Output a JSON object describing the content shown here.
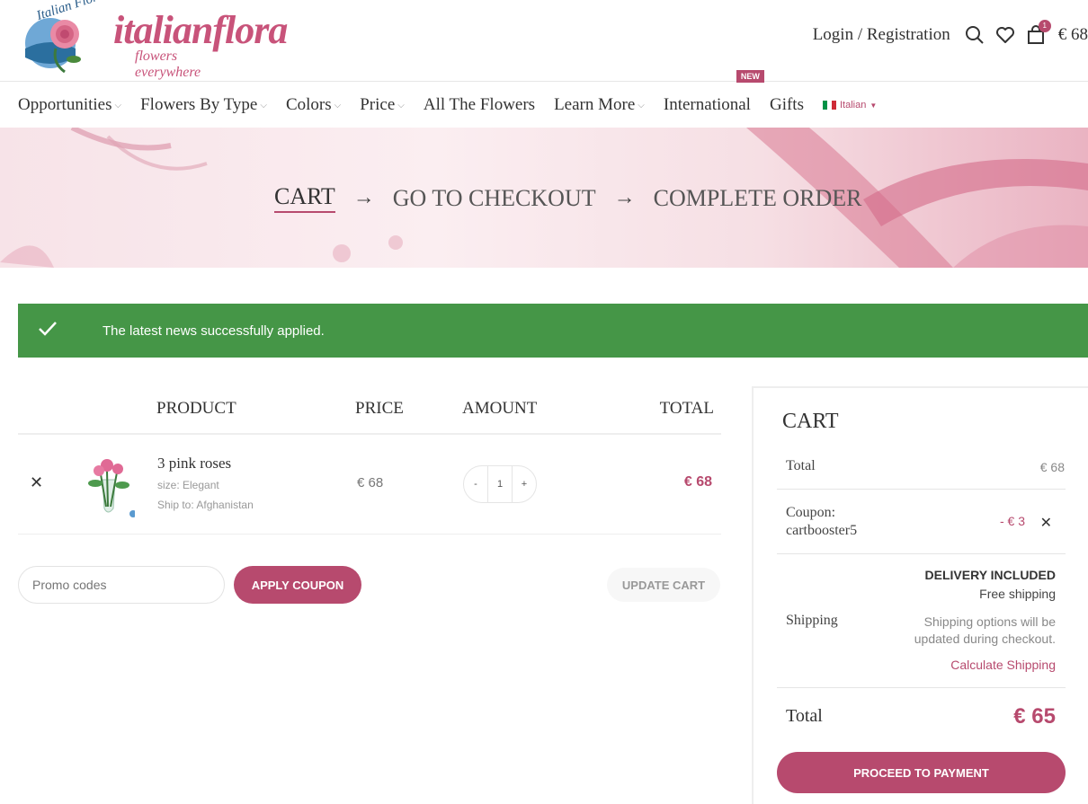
{
  "brand": {
    "logo_top": "Italian Flora",
    "wordmark": "italianflora",
    "tagline": "flowers everywhere"
  },
  "header": {
    "login_label": "Login / Registration",
    "cart_count": "1",
    "cart_total": "€ 68"
  },
  "nav": {
    "items": [
      {
        "label": "Opportunities",
        "has_dropdown": true
      },
      {
        "label": "Flowers By Type",
        "has_dropdown": true
      },
      {
        "label": "Colors",
        "has_dropdown": true
      },
      {
        "label": "Price",
        "has_dropdown": true
      },
      {
        "label": "All The Flowers",
        "has_dropdown": false
      },
      {
        "label": "Learn More",
        "has_dropdown": true
      },
      {
        "label": "International",
        "has_dropdown": false
      },
      {
        "label": "Gifts",
        "has_dropdown": false
      }
    ],
    "new_badge": "NEW",
    "language": "Italian"
  },
  "steps": {
    "cart": "CART",
    "checkout": "GO TO CHECKOUT",
    "complete": "COMPLETE ORDER",
    "arrow": "→"
  },
  "notice": {
    "message": "The latest news successfully applied.",
    "icon": "check-icon"
  },
  "table": {
    "headers": {
      "product": "PRODUCT",
      "price": "PRICE",
      "amount": "AMOUNT",
      "total": "TOTAL"
    },
    "rows": [
      {
        "name": "3 pink roses",
        "size": "size: Elegant",
        "ship_to": "Ship to: Afghanistan",
        "price": "€ 68",
        "qty": "1",
        "minus": "-",
        "plus": "+",
        "total": "€ 68"
      }
    ]
  },
  "coupon": {
    "placeholder": "Promo codes",
    "apply_label": "APPLY COUPON",
    "update_label": "UPDATE CART"
  },
  "totals": {
    "title": "CART",
    "subtotal_label": "Total",
    "subtotal_value": "€ 68",
    "coupon_label": "Coupon:",
    "coupon_code": "cartbooster5",
    "coupon_value": "- € 3",
    "shipping_label": "Shipping",
    "delivery_included": "DELIVERY INCLUDED",
    "free_shipping": "Free shipping",
    "shipping_note": "Shipping options will be updated during checkout.",
    "calc_shipping": "Calculate Shipping",
    "grand_label": "Total",
    "grand_value": "€ 65",
    "proceed_label": "PROCEED TO PAYMENT"
  },
  "colors": {
    "accent": "#b74a6e",
    "success": "#459647"
  }
}
